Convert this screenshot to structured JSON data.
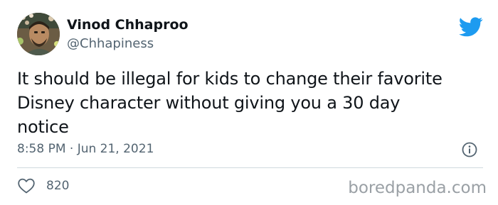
{
  "author": {
    "display_name": "Vinod Chhaproo",
    "handle": "@Chhapiness",
    "avatar_icon": "profile-photo"
  },
  "tweet": {
    "text_lines": [
      "It should be illegal for kids to change their favorite",
      "Disney character without giving you a 30 day",
      "notice"
    ],
    "timestamp": "8:58 PM · Jun 21, 2021"
  },
  "actions": {
    "like_icon": "heart-icon",
    "like_count": "820",
    "info_icon": "info-icon"
  },
  "brand": {
    "platform_icon": "twitter-bird-icon",
    "accent_color": "#1d9bf0"
  },
  "watermark": "boredpanda.com"
}
